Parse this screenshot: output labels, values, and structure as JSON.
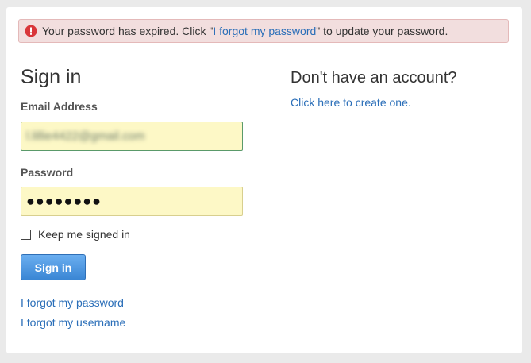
{
  "alert": {
    "icon": "error-icon",
    "prefix": "Your password has expired. Click \"",
    "link_text": "I forgot my password",
    "suffix": "\" to update your password."
  },
  "signin": {
    "title": "Sign in",
    "email_label": "Email Address",
    "email_value": "l.lillie4422@gmail.com",
    "password_label": "Password",
    "password_dots": "●●●●●●●●",
    "remember_label": "Keep me signed in",
    "remember_checked": false,
    "submit_label": "Sign in",
    "forgot_password": "I forgot my password",
    "forgot_username": "I forgot my username"
  },
  "signup": {
    "title": "Don't have an account?",
    "link_text": "Click here to create one."
  },
  "colors": {
    "link": "#2a6eb8",
    "alert_bg": "#f2dede",
    "field_bg": "#fdf8c6",
    "button": "#3a86d4"
  }
}
